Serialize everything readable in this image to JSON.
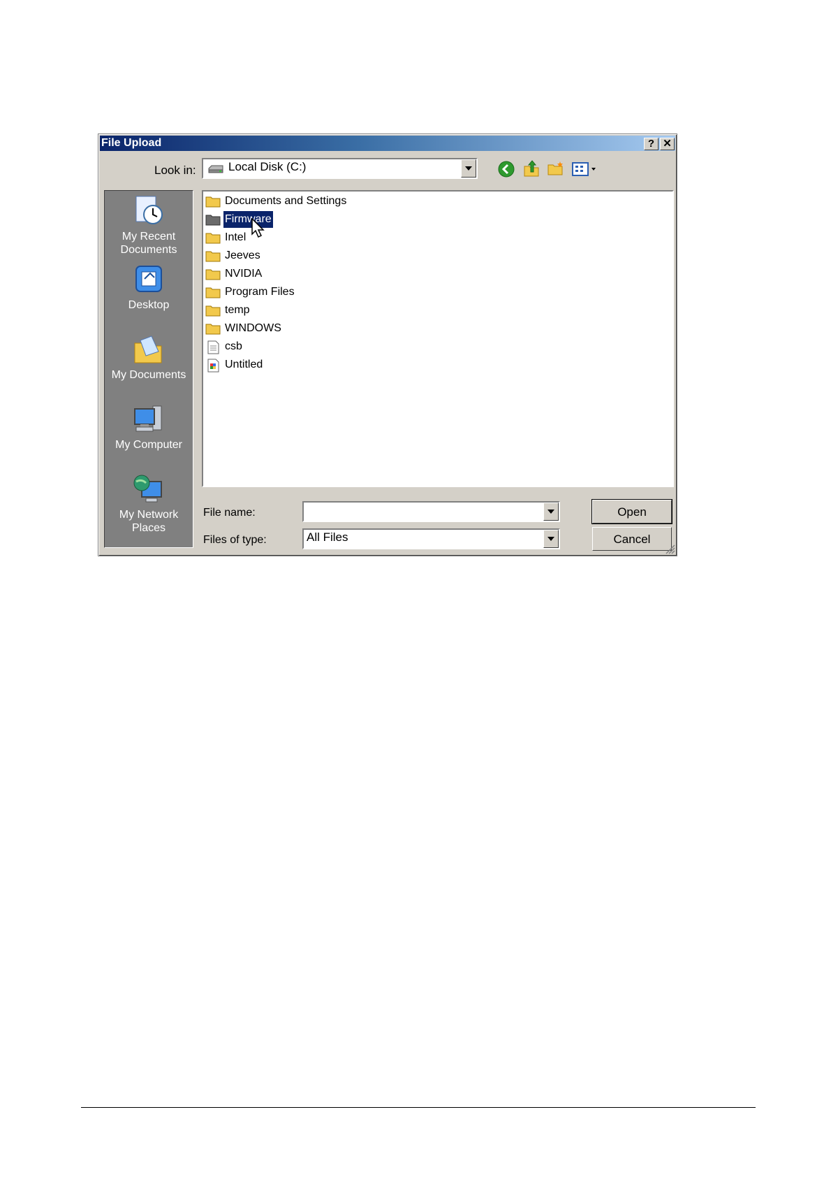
{
  "dialog": {
    "title": "File Upload",
    "help_label": "?",
    "close_label": "✕",
    "look_in_label": "Look in:",
    "look_in_value": "Local Disk (C:)",
    "file_name_label": "File name:",
    "file_name_value": "",
    "files_of_type_label": "Files of type:",
    "files_of_type_value": "All Files",
    "open_label": "Open",
    "cancel_label": "Cancel"
  },
  "toolbar": {
    "icons": [
      "back-icon",
      "up-folder-icon",
      "new-folder-icon",
      "view-menu-icon"
    ]
  },
  "places": [
    {
      "label": "My Recent Documents",
      "icon": "recent-documents-icon"
    },
    {
      "label": "Desktop",
      "icon": "desktop-icon"
    },
    {
      "label": "My Documents",
      "icon": "my-documents-icon"
    },
    {
      "label": "My Computer",
      "icon": "my-computer-icon"
    },
    {
      "label": "My Network Places",
      "icon": "network-places-icon"
    }
  ],
  "files": [
    {
      "name": "Documents and Settings",
      "type": "folder",
      "selected": false
    },
    {
      "name": "Firmware",
      "type": "folder",
      "selected": true
    },
    {
      "name": "Intel",
      "type": "folder",
      "selected": false
    },
    {
      "name": "Jeeves",
      "type": "folder",
      "selected": false
    },
    {
      "name": "NVIDIA",
      "type": "folder",
      "selected": false
    },
    {
      "name": "Program Files",
      "type": "folder",
      "selected": false
    },
    {
      "name": "temp",
      "type": "folder",
      "selected": false
    },
    {
      "name": "WINDOWS",
      "type": "folder",
      "selected": false
    },
    {
      "name": "csb",
      "type": "text-file",
      "selected": false
    },
    {
      "name": "Untitled",
      "type": "image-file",
      "selected": false
    }
  ],
  "colors": {
    "dialog_bg": "#d4d0c8",
    "title_start": "#0a246a",
    "title_end": "#a6caf0",
    "selection": "#0a246a",
    "places_bg": "#808080",
    "folder": "#f2c94c"
  }
}
